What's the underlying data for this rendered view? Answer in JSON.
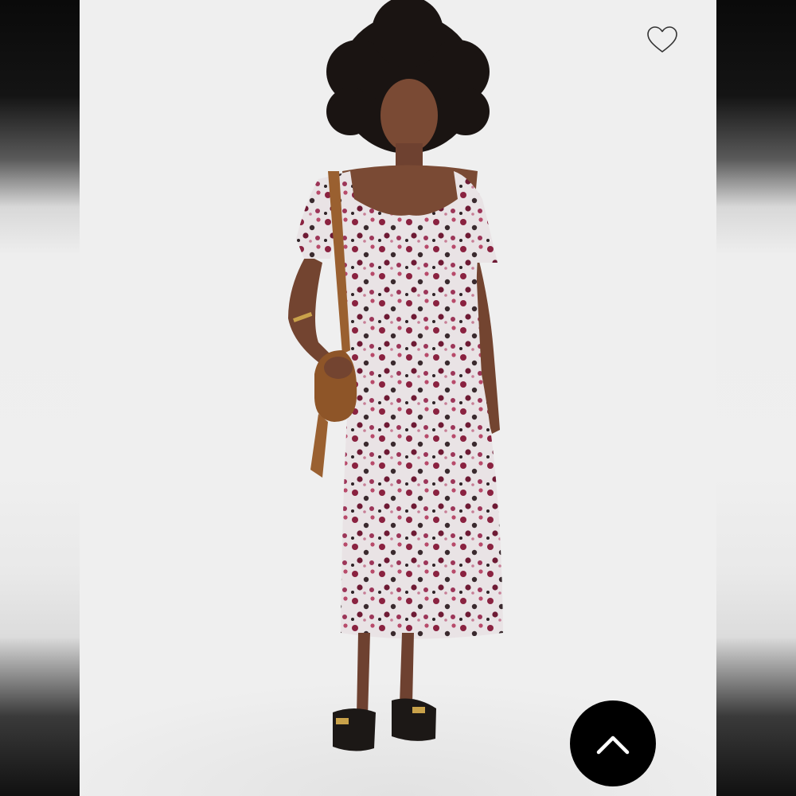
{
  "product_image": {
    "alt": "",
    "favorite_icon": "heart-outline-icon",
    "scroll_top_icon": "chevron-up-icon"
  },
  "colors": {
    "backdrop": "#efefef",
    "dress_base": "#e8e2e4",
    "dress_print": "#8a2240",
    "bag": "#9a6030",
    "hair": "#1a1412",
    "skin": "#7a4a34",
    "button": "#000000"
  }
}
